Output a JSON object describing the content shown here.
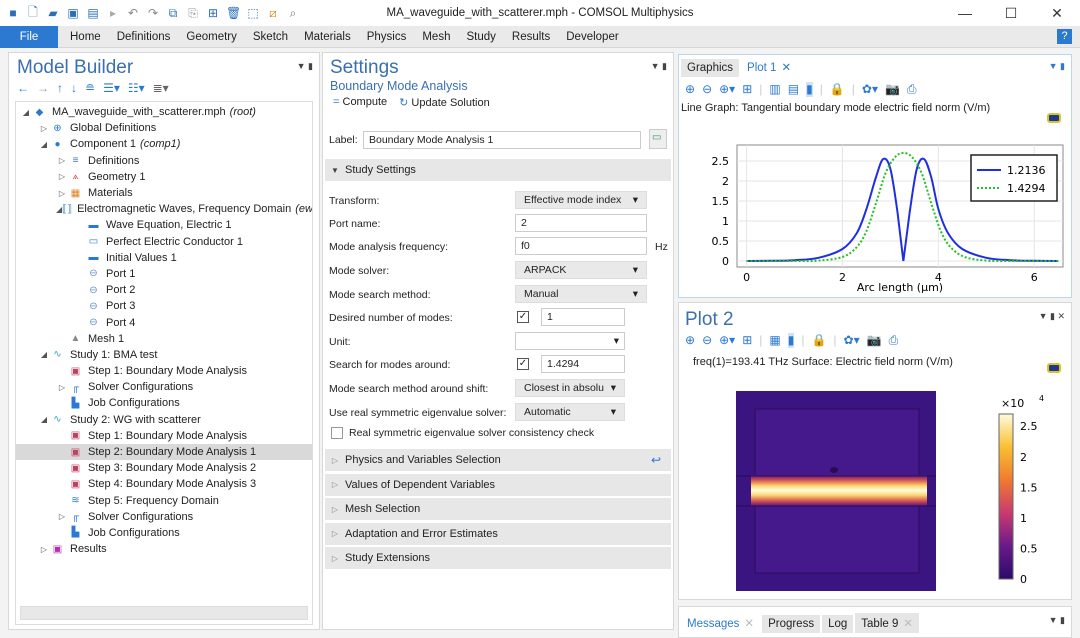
{
  "window": {
    "title": "MA_waveguide_with_scatterer.mph - COMSOL Multiphysics",
    "controls": [
      "minimize",
      "maximize",
      "close"
    ]
  },
  "quick_access": [
    "app-icon",
    "new-icon",
    "open-icon",
    "save-icon",
    "save-as-icon",
    "run-icon",
    "undo-icon",
    "redo-icon",
    "copy-icon",
    "paste-icon",
    "duplicate-icon",
    "delete-icon",
    "select-icon",
    "clear-icon",
    "find-icon"
  ],
  "menu": {
    "file": "File",
    "items": [
      "Home",
      "Definitions",
      "Geometry",
      "Sketch",
      "Materials",
      "Physics",
      "Mesh",
      "Study",
      "Results",
      "Developer"
    ],
    "help": "?"
  },
  "model_builder": {
    "title": "Model Builder",
    "tree": [
      {
        "level": 0,
        "toggle": "◢",
        "icon": "root-icon",
        "label": "MA_waveguide_with_scatterer.mph",
        "tag": "(root)"
      },
      {
        "level": 1,
        "toggle": "▷",
        "icon": "globe-icon",
        "label": "Global Definitions",
        "tag": ""
      },
      {
        "level": 1,
        "toggle": "◢",
        "icon": "component-icon",
        "label": "Component 1",
        "tag": "(comp1)"
      },
      {
        "level": 2,
        "toggle": "▷",
        "icon": "definitions-icon",
        "label": "Definitions",
        "tag": ""
      },
      {
        "level": 2,
        "toggle": "▷",
        "icon": "geometry-icon",
        "label": "Geometry 1",
        "tag": ""
      },
      {
        "level": 2,
        "toggle": "▷",
        "icon": "materials-icon",
        "label": "Materials",
        "tag": ""
      },
      {
        "level": 2,
        "toggle": "◢",
        "icon": "physics-icon",
        "label": "Electromagnetic Waves, Frequency Domain",
        "tag": "(ew"
      },
      {
        "level": 3,
        "toggle": "",
        "icon": "domain-node-icon",
        "label": "Wave Equation, Electric 1",
        "tag": ""
      },
      {
        "level": 3,
        "toggle": "",
        "icon": "boundary-node-icon",
        "label": "Perfect Electric Conductor 1",
        "tag": ""
      },
      {
        "level": 3,
        "toggle": "",
        "icon": "domain-node-icon",
        "label": "Initial Values 1",
        "tag": ""
      },
      {
        "level": 3,
        "toggle": "",
        "icon": "port-icon",
        "label": "Port 1",
        "tag": ""
      },
      {
        "level": 3,
        "toggle": "",
        "icon": "port-icon",
        "label": "Port 2",
        "tag": ""
      },
      {
        "level": 3,
        "toggle": "",
        "icon": "port-icon",
        "label": "Port 3",
        "tag": ""
      },
      {
        "level": 3,
        "toggle": "",
        "icon": "port-icon",
        "label": "Port 4",
        "tag": ""
      },
      {
        "level": 2,
        "toggle": "",
        "icon": "mesh-icon",
        "label": "Mesh 1",
        "tag": ""
      },
      {
        "level": 1,
        "toggle": "◢",
        "icon": "study-icon",
        "label": "Study 1: BMA test",
        "tag": ""
      },
      {
        "level": 2,
        "toggle": "",
        "icon": "step-icon",
        "label": "Step 1: Boundary Mode Analysis",
        "tag": ""
      },
      {
        "level": 2,
        "toggle": "▷",
        "icon": "solver-icon",
        "label": "Solver Configurations",
        "tag": ""
      },
      {
        "level": 2,
        "toggle": "",
        "icon": "job-icon",
        "label": "Job Configurations",
        "tag": ""
      },
      {
        "level": 1,
        "toggle": "◢",
        "icon": "study-icon",
        "label": "Study 2: WG with scatterer",
        "tag": ""
      },
      {
        "level": 2,
        "toggle": "",
        "icon": "step-icon",
        "label": "Step 1: Boundary Mode Analysis",
        "tag": ""
      },
      {
        "level": 2,
        "toggle": "",
        "icon": "step-icon",
        "label": "Step 2: Boundary Mode Analysis 1",
        "tag": "",
        "selected": true
      },
      {
        "level": 2,
        "toggle": "",
        "icon": "step-icon",
        "label": "Step 3: Boundary Mode Analysis 2",
        "tag": ""
      },
      {
        "level": 2,
        "toggle": "",
        "icon": "step-icon",
        "label": "Step 4: Boundary Mode Analysis 3",
        "tag": ""
      },
      {
        "level": 2,
        "toggle": "",
        "icon": "frequency-domain-icon",
        "label": "Step 5: Frequency Domain",
        "tag": ""
      },
      {
        "level": 2,
        "toggle": "▷",
        "icon": "solver-icon",
        "label": "Solver Configurations",
        "tag": ""
      },
      {
        "level": 2,
        "toggle": "",
        "icon": "job-icon",
        "label": "Job Configurations",
        "tag": ""
      },
      {
        "level": 1,
        "toggle": "▷",
        "icon": "results-icon",
        "label": "Results",
        "tag": ""
      }
    ]
  },
  "settings": {
    "title": "Settings",
    "subtitle": "Boundary Mode Analysis",
    "compute": "Compute",
    "update": "Update Solution",
    "label_caption": "Label:",
    "label_value": "Boundary Mode Analysis 1",
    "study_settings": "Study Settings",
    "fields": {
      "transform": {
        "label": "Transform:",
        "value": "Effective mode index"
      },
      "port": {
        "label": "Port name:",
        "value": "2"
      },
      "freq": {
        "label": "Mode analysis frequency:",
        "value": "f0",
        "unit": "Hz"
      },
      "solver": {
        "label": "Mode solver:",
        "value": "ARPACK"
      },
      "method": {
        "label": "Mode search method:",
        "value": "Manual"
      },
      "nmodes": {
        "label": "Desired number of modes:",
        "value": "1",
        "checked": true
      },
      "unit": {
        "label": "Unit:",
        "value": ""
      },
      "around": {
        "label": "Search for modes around:",
        "value": "1.4294",
        "checked": true
      },
      "shift": {
        "label": "Mode search method around shift:",
        "value": "Closest in absolu"
      },
      "realsym": {
        "label": "Use real symmetric eigenvalue solver:",
        "value": "Automatic"
      },
      "consistency": {
        "label": "Real symmetric eigenvalue solver consistency check",
        "checked": false
      }
    },
    "sections": [
      "Physics and Variables Selection",
      "Values of Dependent Variables",
      "Mesh Selection",
      "Adaptation and Error Estimates",
      "Study Extensions"
    ]
  },
  "graphics": {
    "tabs": [
      "Graphics",
      "Plot 1"
    ],
    "active_tab": "Plot 1",
    "plot_title": "Line Graph: Tangential boundary mode electric field norm (V/m)"
  },
  "chart_data": [
    {
      "type": "line",
      "title": "Line Graph: Tangential boundary mode electric field norm (V/m)",
      "xlabel": "Arc length (µm)",
      "ylabel": "",
      "xlim": [
        -0.2,
        6.6
      ],
      "ylim": [
        -0.15,
        2.9
      ],
      "xticks": [
        0,
        2,
        4,
        6
      ],
      "yticks": [
        0,
        0.5,
        1,
        1.5,
        2,
        2.5
      ],
      "grid": true,
      "legend": "top-right",
      "series": [
        {
          "name": "1.2136",
          "color": "#1f2fe0",
          "style": "solid",
          "x": [
            0,
            0.5,
            1,
            1.5,
            2,
            2.3,
            2.5,
            2.7,
            2.85,
            3.0,
            3.15,
            3.27,
            3.4,
            3.55,
            3.7,
            3.85,
            4.0,
            4.2,
            4.5,
            5,
            5.5,
            6,
            6.5
          ],
          "y": [
            0,
            0.005,
            0.02,
            0.08,
            0.3,
            0.7,
            1.3,
            2.1,
            2.55,
            2.3,
            1.2,
            0,
            1.2,
            2.3,
            2.55,
            2.1,
            1.3,
            0.7,
            0.3,
            0.08,
            0.02,
            0.005,
            0
          ]
        },
        {
          "name": "1.4294",
          "color": "#22c022",
          "style": "dotted",
          "x": [
            0,
            1,
            1.5,
            2,
            2.3,
            2.5,
            2.7,
            2.9,
            3.1,
            3.27,
            3.45,
            3.65,
            3.85,
            4.05,
            4.25,
            4.55,
            5,
            5.5,
            6.5
          ],
          "y": [
            0,
            0,
            0.01,
            0.1,
            0.35,
            0.75,
            1.45,
            2.2,
            2.6,
            2.7,
            2.6,
            2.2,
            1.45,
            0.75,
            0.35,
            0.1,
            0.01,
            0,
            0
          ]
        }
      ]
    },
    {
      "type": "heatmap",
      "title": "freq(1)=193.41 THz   Surface: Electric field norm (V/m)",
      "colorbar": {
        "label": "×10^4",
        "ticks": [
          0,
          0.5,
          1,
          1.5,
          2,
          2.5
        ],
        "range": [
          0,
          2.7
        ]
      }
    }
  ],
  "plot2": {
    "title": "Plot 2",
    "caption": "freq(1)=193.41 THz   Surface: Electric field norm (V/m)",
    "colorbar_exp": "×10",
    "colorbar_pow": "4"
  },
  "messages": {
    "tabs": [
      "Messages",
      "Progress",
      "Log",
      "Table 9"
    ]
  }
}
